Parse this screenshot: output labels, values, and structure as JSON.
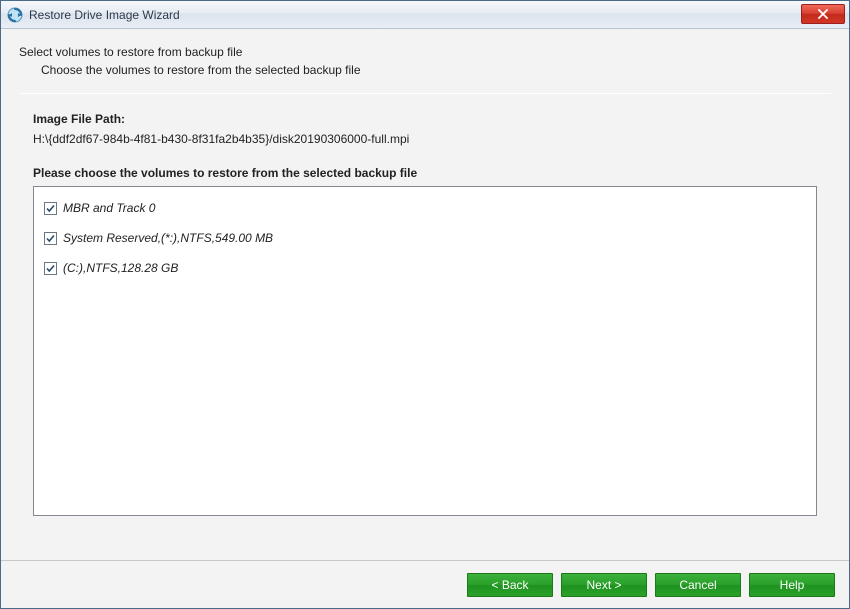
{
  "window": {
    "title": "Restore Drive Image Wizard"
  },
  "header": {
    "heading": "Select volumes to restore from backup file",
    "subheading": "Choose the volumes to restore from the selected backup file"
  },
  "image_path": {
    "label": "Image File Path:",
    "value": "H:\\{ddf2df67-984b-4f81-b430-8f31fa2b4b35}/disk20190306000-full.mpi"
  },
  "volumes": {
    "prompt": "Please choose the volumes to restore from the selected backup file",
    "items": [
      {
        "label": "MBR and Track 0",
        "checked": true
      },
      {
        "label": "System Reserved,(*:),NTFS,549.00 MB",
        "checked": true
      },
      {
        "label": "(C:),NTFS,128.28 GB",
        "checked": true
      }
    ]
  },
  "buttons": {
    "back": "< Back",
    "next": "Next >",
    "cancel": "Cancel",
    "help": "Help"
  }
}
